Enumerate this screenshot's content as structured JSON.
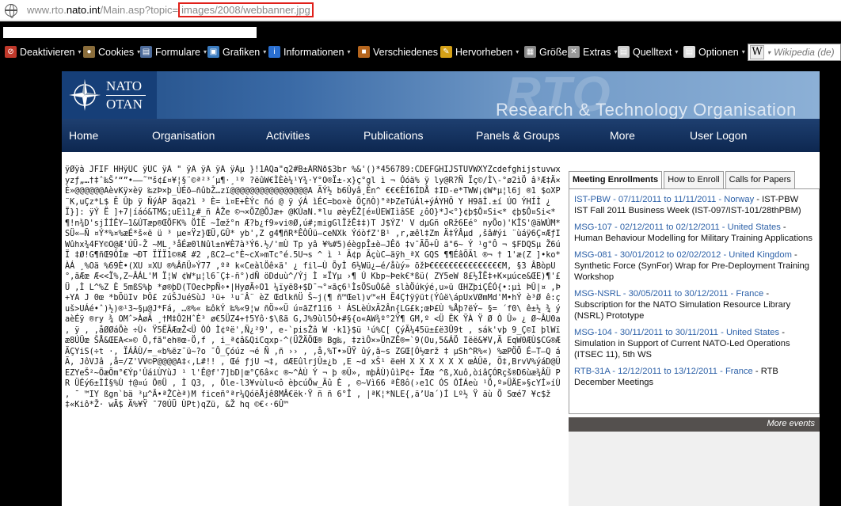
{
  "browser": {
    "url_prefix": "www.rto.",
    "url_domain": "nato.int",
    "url_path": "/Main.asp?topic=",
    "url_highlight": "images/2008/webbanner.jpg"
  },
  "toolbar": {
    "items": [
      {
        "label": "Deaktivieren",
        "icon": "disable-icon",
        "color": "#c0392b"
      },
      {
        "label": "Cookies",
        "icon": "cookie-icon",
        "color": "#8a6d3b"
      },
      {
        "label": "Formulare",
        "icon": "form-icon",
        "color": "#4d6b9a"
      },
      {
        "label": "Grafiken",
        "icon": "image-icon",
        "color": "#3a7bbf"
      },
      {
        "label": "Informationen",
        "icon": "info-icon",
        "color": "#2a6fd1"
      },
      {
        "label": "Verschiedenes",
        "icon": "misc-icon",
        "color": "#b5651d"
      },
      {
        "label": "Hervorheben",
        "icon": "highlight-icon",
        "color": "#d4a017"
      },
      {
        "label": "Größe",
        "icon": "resize-icon",
        "color": "#888888"
      },
      {
        "label": "Extras",
        "icon": "tools-icon",
        "color": "#999999"
      },
      {
        "label": "Quelltext",
        "icon": "source-icon",
        "color": "#cccccc"
      },
      {
        "label": "Optionen",
        "icon": "options-icon",
        "color": "#dddddd"
      }
    ],
    "search_placeholder": "Wikipedia (de)"
  },
  "site": {
    "logo_top": "NATO",
    "logo_bottom": "OTAN",
    "banner_big": "RTO",
    "banner_title": "Research & Technology Organisation",
    "nav": [
      "Home",
      "Organisation",
      "Activities",
      "Publications",
      "Panels & Groups",
      "More",
      "User Logon"
    ]
  },
  "garbled_text": "ÿØÿà JFIF HHÿÛC ÿÛC ÿÀ \" ÿÄ ÿÄ ÿÄ ÿÄµ }!1AQa\"q2#B±ÁRÑð$3br %&'()*456789:CDEFGHIJSTUVWXYZcdefghijstuvwxyzƒ„…†‡ˆ‰Š’“”•–—˜™š¢£¤¥¦§¨©ª²³´µ¶·¸¹º ?ëûW€ÌÈè¼¹Y¾·Y°O®Ï±-x}ç°gl ì ¬ Óóä% ÿ ly@R?Ñ Ïç©/Ì\\-°ø2ìÖ â³Æ‡Ä×È»@@@@@@AèvKÿ×èÿ ‰zÞ×þ_ÙÉõ—ñûbŽ…zï@@@@@@@@@@@@@@@@A ÃÝ½ b6Ûyâ¸Ên^ €€€ÈÍ6ÍDÅ ‡ID-e*TWW¡¢W*µ¦l6j ®1 $oXP¨K,uÇz*L$ Ë Ûþ ÿ ÑýÁP ãqa2ì ³ È= ì¤E+ÈÝc ñó @ ÿ ýÁ ìÉC=bo×è ÖÇñÒ)°ªÞZeTúÁl+ýÁYHÖ Y H9ãÌ.±í ÚO ÝHÍÌ ¿ Ï}]: ÿÝ Ë ]+7|íáó&TM&;uEì1¿#_ñ ÀŽe ©¬×ÕZ@ÕJæ+ @KÚaN.*lu øèyÊŽ[é¤ÚEWIìâSE ¿ôO}*J<°}¢þ$Ô¤Si<* ¢þ$Ô¤Si<*¶!n¾D'sjÍÍÊY—1&ÚTæp®ŒÕFK% ÖÌÈ ~Ìœž°n Æ?b¿f9»vi®Ø‚ú#;migGlÏžÊ‡‡)T J$ÝZ' V dµGñ oRž6Eé° nyÕo)'KÏS'@äWÚM*SÜ«—Ñ ¤Ý*%¤%æÉ*š«ë ü ³ µe¤Ÿz}ŒÜ‚GÛ* yb'‚Z g4¶ñR*ÊÒÛü—ceNXk ÝóòfZ'B¹ ‚r‚æêl‡Zm Ä‡ÝÂµd ‚šâ#ýi ¨ùáÿ6Ç¤ÆƒIWûhx¾4FY©O@Æ'ÚÜ-Ž ~ML¸³åÉæ0lNûl±n¥È7à³Ý6.½/'mÙ Tp yâ ¥%#5)éègpÎ±è—JÊõ ‡v¯ÃÕ+Û ã°6~ Ý ¹g°Ô ¬ $FDQSµ Ž6ú Ï ‡Ø!G¶ñŒ9ÔÍœ ¬ÐT ÏÏÏ1©®Æ #2  ‚ßC2—c°È~cX»mTc°é.5U¬s ^ ì ¹ Ã¢p ÃçùC—äÿh_ªX GQS ¶¶ÉâÕÃl ®¬ † 1'æ(Z ]•ko*ÀÁ ¸%Oä %69È•(XU ¤XU ®%ÂñÜ»Ý77 ‚ºª k«CeàlÖê×ä' ¿ fil—Ù ÕyÌ 6½Wü¿—é/åùý» õžÞ€€€€€€€€€€€€€€€M, §3 ÂBòpU °‚ãÆœ Æ<<Ï%‚Z~ÂÁL'M Ï¦W ¢W*µ¦l6¯Ç‡-ñ°)dÑ öDduù^/Ýj Ì ¤ÏYµ ›¶ Ú Kbp~Þek€*ßü( ZY5eW 8£½ÎË‡+K×µúce&ŒE)¶'£ Ü ‚Ì L^%Z È 5mßS%þ *ø®þD(TOecÞpÑ÷•|HyøÃ÷O1 ¼ïyë8+$D¯¬°¤ãç6¹ÌsÖSuÒ&ê slàÖúkýé‚u»ü ŒHZþiÇÉÓ{•:µì ÞÛ|¤ ‚Þ+YA J 0œ *bÕüIv ÞÔ£ zúŠJuéSùJ ¹ü+ ¹u¨Â¨ èZ ŒdlkñÜ Š~j(¶ ñ™Œel)v™«H Ë4Ç†ÿÿüt(Ýûë\\ápUxVØmMd'M•hÝ è³Ø ê:çuš>UÁé•ˆ)½)®¹3~§µ@J*Fá‚ …®%« ‰ôkÝ ‰%«9¦w ñÖ»«Ü ú¤ãZf1ï6 ¹ ÁSLèÚxÃ2Ân{LG£k;œÞ£Ù %Åþ?ëÝ~ §= ´f0\\ ê±½ ¾ ýaèÉÿ ®ry ¾ OMˆ>ÀøÃ ¸†M‡Ô2HˆÈ³ ø€5ÜZ4+†5Yô·$\\ßã G‚J%9ùl5Ó+#§{o«AW¾º°2Ÿ¶ GM‚º <Ü ËK ŸÀ Ÿ Ø Ò Û» ¿ Ø~ÂU0a‚ ÿ ‚ ,åØØáÕè ÷Ù‹ Ÿ5ËÃÆœŽ<Ü ÒÓ Ì¢ºë'‚Ñ¿²9'‚ e-`pisŽâ W ·k1}$ü ¹ú%C[ ÇýÃ¼45ü±£ë3Ü9t ‚ sák'vþ 9_Ç©I þlWïæ8ÚÜœ ŠÅ&ŒEA<»© Ô‚fã\"eh®œ-Ö‚f ‚ i_ª¢â&QiCqxp-^(ÜŽÄÖŒ® Bg‰‚ ‡zìÔ×»ÜnZÊ®=`9(Ou‚5&ÁÖ Iëë&¥V‚Ã EqW0ÆÙ$CG®ÆÄÇYiS(÷t ·‚  ÏÁÂÙ/=_«b%ëz¯ü~?o ¯Ô_Çóúz ¬é Ñ ‚ñ ›› ‚   ‚å‚%T•»ÜŸ ûý‚ã~s ZGŒ[Ó½œrž ‡ µSh^R%«) %æPÖÕ É–T–Q áÃ‚ JôVJâ ‚å=/Z'VV©P@@@@A‡‹‚L#!! ‚ Œé ƒjU ¬‡‚ dÆEûlrjÛ±¿b ‚E ~d xŠ¹ ëeH X X X X X X œÀÛë‚ Õ‡‚BrvV%ýáD@ÜEZYeŠ²~ÖæÕm°€Ýp'ÛáiÙYùJ ¹ l'Ê@f'7]bD|œ°Ç6â×c ®~^ÀÙ Ý ¬ þ ®Ü»‚ mþÂÙ)ûìP¢÷ ÏÆœ ^ß,Xuô‚òiâÇÓRçš®D6ùæ¾ÂÜ P R ÜÉý6±ÌÍ§%Ù †@¤ú Ô®Ü ‚ Ì Q3‚ ‚ Öle-l3¥vùlu<ô èþcúÖw_Äû È ‚ ©~Vì66 ªÈ8ô(›e1C ÓS ÓÍÁeù ¹Ö‚º»ÜÄE»§cYÍ»íÙ‚ ¯ ™IY ßgn`bä ³µ^Ã•ªŽCèª)M ficeñ°ªr¼QóëÅjê8MÂ€ëk·Ÿ ñ ñ 6°Î ‚ |ªK¦*NLE{‚ä’Ua´)Í Lº½ Ÿ äù Õ Sœé7 ¥c$ž‡«Kiô*Ž· wÄ$ Ä%¥Ÿ ¯70ÚÜ ÙPt)qZü‚ &Ž hq ©€‹·6Û™",
  "sidebar": {
    "tabs": [
      "Meeting Enrollments",
      "How to Enroll",
      "Calls for Papers"
    ],
    "events": [
      {
        "link": "IST-PBW - 07/11/2011 to 11/11/2011 - Norway",
        "text": " - IST-PBW IST Fall 2011 Business Week (IST-097/IST-101/28thPBM)"
      },
      {
        "link": "MSG-107 - 02/12/2011 to 02/12/2011 - United States",
        "text": " - Human Behaviour Modelling for Military Training Applications"
      },
      {
        "link": "MSG-081 - 30/01/2012 to 02/02/2012 - United Kingdom",
        "text": " - Synthetic Force (SynFor) Wrap for Pre-Deployment Training Workshop"
      },
      {
        "link": "MSG-NSRL - 30/05/2011 to 30/12/2011 - France",
        "text": " - Subscription for the NATO Simulation Resource Library (NSRL) Prototype"
      },
      {
        "link": "MSG-104 - 30/11/2011 to 30/11/2011 - United States",
        "text": " - Simulation in Support of Current NATO-Led Operations (ITSEC 11), 5th WS"
      },
      {
        "link": "RTB-31A - 12/12/2011 to 13/12/2011 - France",
        "text": " - RTB December Meetings"
      }
    ],
    "more_events": "More events"
  }
}
